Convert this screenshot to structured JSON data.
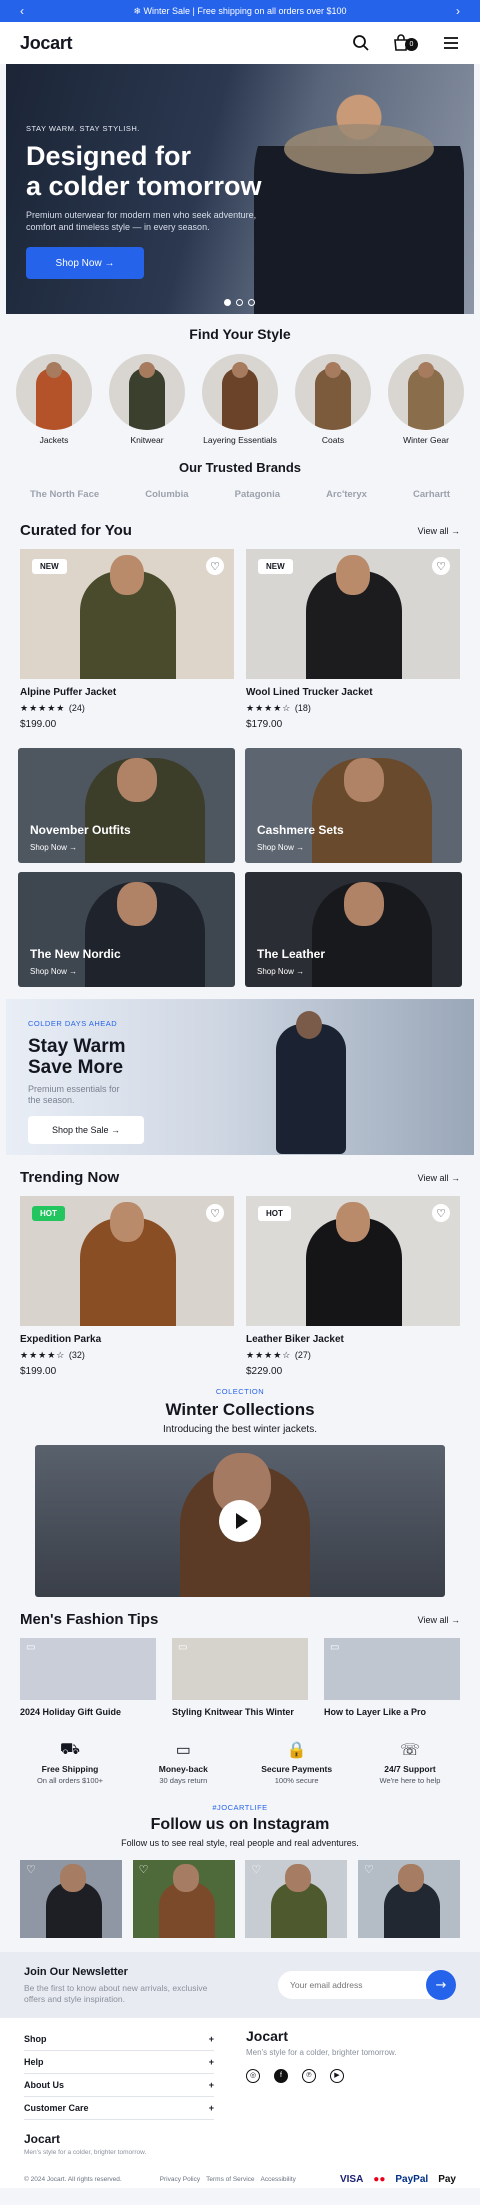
{
  "topbar": {
    "message": "❄ Winter Sale  |  Free shipping on all orders over $100",
    "prev": "‹",
    "next": "›"
  },
  "header": {
    "logo": "Jocart",
    "cart_count": "0"
  },
  "hero": {
    "eyebrow": "STAY WARM. STAY STYLISH.",
    "title_line1": "Designed for",
    "title_line2": "a colder tomorrow",
    "subtitle": "Premium outerwear for modern men who seek adventure, comfort and timeless style — in every season.",
    "cta": "Shop Now →"
  },
  "find_style": {
    "title": "Find Your Style",
    "categories": [
      {
        "label": "Jackets",
        "color": "#b4532a"
      },
      {
        "label": "Knitwear",
        "color": "#3a3f2e"
      },
      {
        "label": "Layering Essentials",
        "color": "#6b4328"
      },
      {
        "label": "Coats",
        "color": "#7c5a3c"
      },
      {
        "label": "Winter Gear",
        "color": "#8a6d4a"
      }
    ]
  },
  "brands": {
    "title": "Our Trusted Brands",
    "items": [
      "The North Face",
      "Columbia",
      "Patagonia",
      "Arc'teryx",
      "Carhartt"
    ]
  },
  "curated": {
    "title": "Curated for You",
    "view_all": "View all →",
    "products": [
      {
        "tag": "NEW",
        "name": "Alpine Puffer Jacket",
        "stars": "★★★★★",
        "count": "(24)",
        "price": "$199.00",
        "bg": "#ddd5c9",
        "color": "#4a4a2c"
      },
      {
        "tag": "NEW",
        "name": "Wool Lined Trucker Jacket",
        "stars": "★★★★☆",
        "count": "(18)",
        "price": "$179.00",
        "bg": "#d7d6d2",
        "color": "#1c1c1e"
      }
    ]
  },
  "collections": [
    {
      "title": "November Outfits",
      "sub": "Shop Now →",
      "bg": "#4e5660",
      "color": "#3c3e2a"
    },
    {
      "title": "Cashmere Sets",
      "sub": "Shop Now →",
      "bg": "#5d6570",
      "color": "#6a4a2c"
    },
    {
      "title": "The New Nordic",
      "sub": "Shop Now →",
      "bg": "#3e4650",
      "color": "#1f232b"
    },
    {
      "title": "The Leather",
      "sub": "Shop Now →",
      "bg": "#2a2d33",
      "color": "#18191c"
    }
  ],
  "banner": {
    "eyebrow": "COLDER DAYS AHEAD",
    "title_line1": "Stay Warm",
    "title_line2": "Save More",
    "subtitle": "Premium essentials for the season.",
    "cta": "Shop the Sale →"
  },
  "trending": {
    "title": "Trending Now",
    "view_all": "View all →",
    "products": [
      {
        "tag": "HOT",
        "name": "Expedition Parka",
        "stars": "★★★★☆",
        "count": "(32)",
        "price": "$199.00",
        "bg": "#d8d3cc",
        "color": "#8a4e25"
      },
      {
        "tag": "HOT",
        "name": "Leather Biker Jacket",
        "stars": "★★★★☆",
        "count": "(27)",
        "price": "$229.00",
        "bg": "#dcdad6",
        "color": "#151517"
      }
    ]
  },
  "winter": {
    "eyebrow": "COLECTION",
    "title": "Winter Collections",
    "subtitle": "Introducing the best winter jackets."
  },
  "tips": {
    "title": "Men's Fashion Tips",
    "view_all": "View all →",
    "items": [
      {
        "label": "2024 Holiday Gift Guide",
        "bg": "#c9ced8"
      },
      {
        "label": "Styling Knitwear This Winter",
        "bg": "#d6d2cc"
      },
      {
        "label": "How to Layer Like a Pro",
        "bg": "#bfc6cf"
      }
    ]
  },
  "features": [
    {
      "icon": "⛟",
      "title": "Free Shipping",
      "sub": "On all orders $100+"
    },
    {
      "icon": "▭",
      "title": "Money-back",
      "sub": "30 days return"
    },
    {
      "icon": "🔒",
      "title": "Secure Payments",
      "sub": "100% secure"
    },
    {
      "icon": "☏",
      "title": "24/7 Support",
      "sub": "We're here to help"
    }
  ],
  "instagram": {
    "tag": "#JOCARTLIFE",
    "title": "Follow us on Instagram",
    "subtitle": "Follow us to see real style, real people and real adventures.",
    "posts": [
      {
        "bg": "#8e97a3",
        "color": "#1d1f24"
      },
      {
        "bg": "#4f6a3a",
        "color": "#7a4a2a"
      },
      {
        "bg": "#c7ccd2",
        "color": "#4e5a2e"
      },
      {
        "bg": "#b4bcc6",
        "color": "#222831"
      }
    ]
  },
  "newsletter": {
    "title": "Join Our Newsletter",
    "subtitle": "Be the first to know about new arrivals, exclusive offers and style inspiration.",
    "placeholder": "Your email address",
    "submit": "→"
  },
  "footer": {
    "menu": [
      "Shop",
      "Help",
      "About Us",
      "Customer Care"
    ],
    "plus": "+",
    "brand": "Jocart",
    "tagline": "Men's style for a colder, brighter tomorrow.",
    "logo_small": "Jocart",
    "tagline_small": "Men's style for a colder, brighter tomorrow.",
    "copyright": "© 2024 Jocart. All rights reserved.",
    "links": [
      "Privacy Policy",
      "Terms of Service",
      "Accessibility"
    ],
    "payments": [
      "VISA",
      "●●",
      "PayPal",
      "Pay"
    ],
    "social": [
      "◎",
      "f",
      "℗",
      "▶"
    ]
  }
}
